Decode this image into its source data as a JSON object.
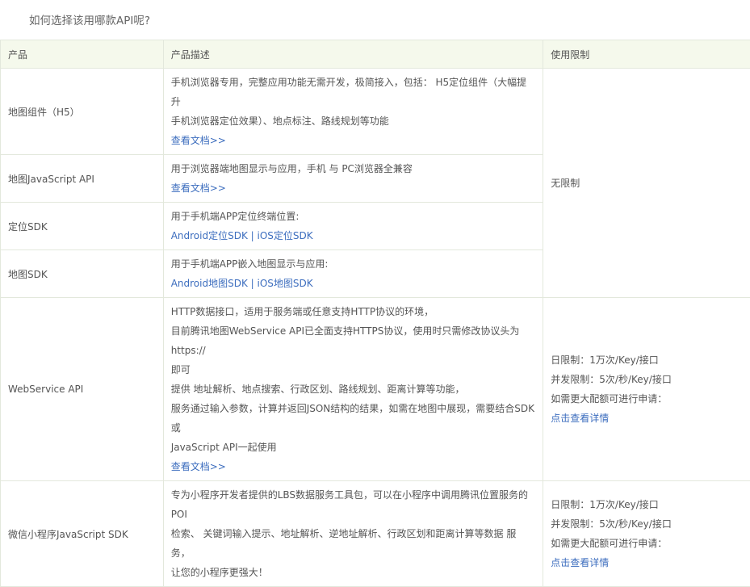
{
  "question": "如何选择该用哪款API呢?",
  "headers": {
    "product": "产品",
    "description": "产品描述",
    "limit": "使用限制"
  },
  "rows": [
    {
      "product": "地图组件（H5）",
      "desc": [
        "手机浏览器专用，完整应用功能无需开发，极简接入，包括： H5定位组件（大幅提升",
        "手机浏览器定位效果）、地点标注、路线规划等功能"
      ],
      "link": "查看文档>>"
    },
    {
      "product": "地图JavaScript API",
      "desc": [
        "用于浏览器端地图显示与应用，手机 与 PC浏览器全兼容"
      ],
      "link": "查看文档>>"
    },
    {
      "product": "定位SDK",
      "desc": [
        "用于手机端APP定位终端位置:"
      ],
      "link_a": "Android定位SDK",
      "link_b": "iOS定位SDK"
    },
    {
      "product": "地图SDK",
      "desc": [
        "用于手机端APP嵌入地图显示与应用:"
      ],
      "link_a": "Android地图SDK",
      "link_b": "iOS地图SDK"
    },
    {
      "product": "WebService API",
      "desc": [
        "HTTP数据接口，适用于服务端或任意支持HTTP协议的环境，",
        "目前腾讯地图WebService API已全面支持HTTPS协议，使用时只需修改协议头为https://",
        "即可",
        "提供 地址解析、地点搜索、行政区划、路线规划、距离计算等功能，",
        "服务通过输入参数，计算并返回JSON结构的结果，如需在地图中展现，需要结合SDK或",
        "JavaScript API一起使用"
      ],
      "link": "查看文档>>"
    },
    {
      "product": "微信小程序JavaScript SDK",
      "desc": [
        "专为小程序开发者提供的LBS数据服务工具包，可以在小程序中调用腾讯位置服务的POI",
        "检索、 关键词输入提示、地址解析、逆地址解析、行政区划和距离计算等数据 服务，",
        "让您的小程序更强大！"
      ]
    }
  ],
  "limit_none": "无限制",
  "limits": {
    "daily": "日限制：1万次/Key/接口",
    "concurrent": "并发限制：5次/秒/Key/接口",
    "apply": "如需更大配额可进行申请：",
    "details_link": "点击查看详情"
  },
  "separator": "|",
  "colors": {
    "header_bg": "#f5f9ec",
    "border": "#e3e8dc",
    "link": "#3c6dbe",
    "text": "#555555"
  }
}
